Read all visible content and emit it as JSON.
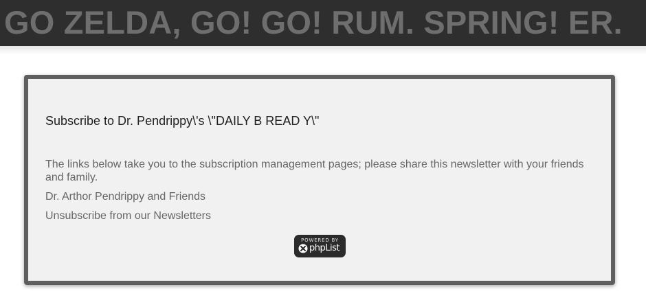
{
  "header": {
    "site_title": "GO ZELDA, GO! GO! RUM. SPRING! ER."
  },
  "subscribe_panel": {
    "list_title": "Subscribe to Dr. Pendrippy\\'s \\\"DAILY B READ Y\\\"",
    "intro_text": "The links below take you to the subscription management pages; please share this newsletter with your friends and family.",
    "signature": "Dr. Arthor Pendrippy and Friends",
    "unsubscribe_label": "Unsubscribe from our Newsletters",
    "badge": {
      "top_text": "POWERED BY",
      "name_text": "phpList",
      "icon": "phplist-logo-icon"
    }
  },
  "colors": {
    "header_background": "#2e2e2e",
    "header_text": "#6e6e6e",
    "panel_background": "#f1f1f1",
    "panel_border": "#5f5f5f",
    "body_text": "#666666",
    "title_text": "#222222",
    "badge_background": "#2b2b2b"
  }
}
